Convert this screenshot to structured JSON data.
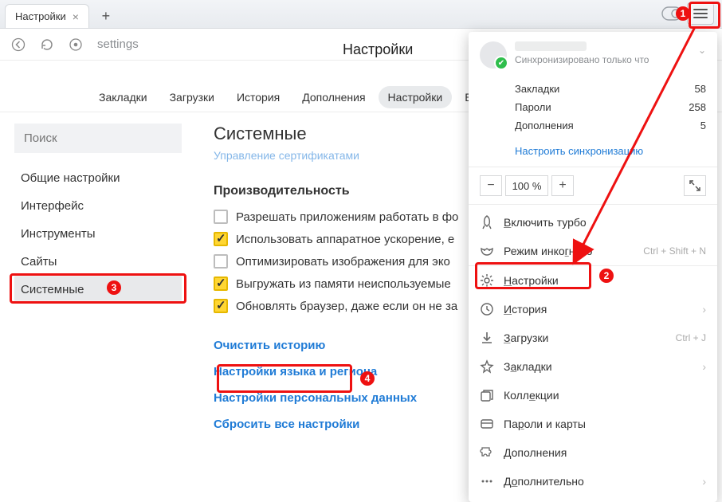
{
  "tab": {
    "title": "Настройки"
  },
  "addressbar": {
    "text": "settings"
  },
  "page": {
    "title": "Настройки"
  },
  "nav": {
    "items": [
      "Закладки",
      "Загрузки",
      "История",
      "Дополнения",
      "Настройки",
      "Безопа"
    ],
    "active_index": 4
  },
  "sidebar": {
    "search_placeholder": "Поиск",
    "items": [
      "Общие настройки",
      "Интерфейс",
      "Инструменты",
      "Сайты",
      "Системные"
    ],
    "active_index": 4
  },
  "main": {
    "heading": "Системные",
    "faded_link": "Управление сертификатами",
    "perf_heading": "Производительность",
    "checks": [
      {
        "label": "Разрешать приложениям работать в фо",
        "checked": false
      },
      {
        "label": "Использовать аппаратное ускорение, е",
        "checked": true
      },
      {
        "label": "Оптимизировать изображения для эко",
        "checked": false
      },
      {
        "label": "Выгружать из памяти неиспользуемые",
        "checked": true
      },
      {
        "label": "Обновлять браузер, даже если он не за",
        "checked": true
      }
    ],
    "links": [
      "Очистить историю",
      "Настройки языка и региона",
      "Настройки персональных данных",
      "Сбросить все настройки"
    ]
  },
  "menu": {
    "sync_sub": "Синхронизировано только что",
    "stats": [
      {
        "label": "Закладки",
        "value": "58"
      },
      {
        "label": "Пароли",
        "value": "258"
      },
      {
        "label": "Дополнения",
        "value": "5"
      }
    ],
    "sync_link": "Настроить синхронизацию",
    "zoom": "100 %",
    "items": [
      {
        "icon": "rocket",
        "label_pre": "",
        "u": "В",
        "label": "ключить турбо",
        "hint": "",
        "arrow": false
      },
      {
        "icon": "mask",
        "label_pre": "Режим инко",
        "u": "г",
        "label": "нито",
        "hint": "Ctrl + Shift + N",
        "arrow": false
      },
      {
        "icon": "gear",
        "label_pre": "",
        "u": "Н",
        "label": "астройки",
        "hint": "",
        "arrow": false,
        "hl": true
      },
      {
        "icon": "clock",
        "label_pre": "",
        "u": "И",
        "label": "стория",
        "hint": "",
        "arrow": true
      },
      {
        "icon": "download",
        "label_pre": "",
        "u": "З",
        "label": "агрузки",
        "hint": "Ctrl + J",
        "arrow": false
      },
      {
        "icon": "star",
        "label_pre": "З",
        "u": "а",
        "label": "кладки",
        "hint": "",
        "arrow": true
      },
      {
        "icon": "collections",
        "label_pre": "Колл",
        "u": "е",
        "label": "кции",
        "hint": "",
        "arrow": false
      },
      {
        "icon": "card",
        "label_pre": "Па",
        "u": "р",
        "label": "оли и карты",
        "hint": "",
        "arrow": false
      },
      {
        "icon": "puzzle",
        "label_pre": "",
        "u": "Д",
        "label": "ополнения",
        "hint": "",
        "arrow": false
      },
      {
        "icon": "more",
        "label_pre": "Д",
        "u": "о",
        "label": "полнительно",
        "hint": "",
        "arrow": true
      }
    ]
  }
}
